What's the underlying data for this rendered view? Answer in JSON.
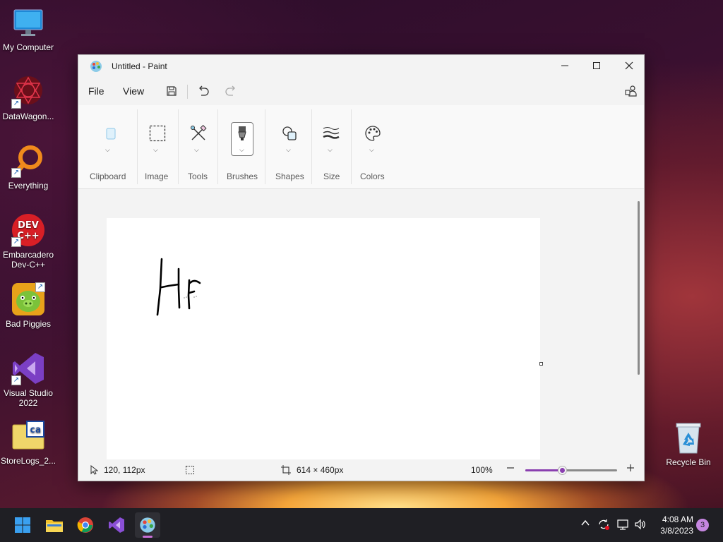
{
  "desktop": {
    "icons": [
      {
        "label": "My Computer"
      },
      {
        "label": "DataWagon..."
      },
      {
        "label": "Everything"
      },
      {
        "label": "Embarcadero Dev-C++"
      },
      {
        "label": "Bad Piggies"
      },
      {
        "label": "Visual Studio 2022"
      },
      {
        "label": "StoreLogs_2..."
      },
      {
        "label": "Recycle Bin"
      }
    ],
    "devcpp_badge": "DEV\nC++"
  },
  "window": {
    "title": "Untitled - Paint",
    "menu": {
      "file": "File",
      "view": "View"
    },
    "ribbon": {
      "groups": [
        {
          "label": "Clipboard"
        },
        {
          "label": "Image"
        },
        {
          "label": "Tools"
        },
        {
          "label": "Brushes"
        },
        {
          "label": "Shapes"
        },
        {
          "label": "Size"
        },
        {
          "label": "Colors"
        }
      ]
    },
    "status": {
      "cursor_pos": "120, 112px",
      "canvas_size": "614 × 460px",
      "zoom": "100%",
      "zoom_fraction": 0.4
    },
    "colors": {
      "accent": "#8a3fb0"
    }
  },
  "taskbar": {
    "time": "4:08 AM",
    "date": "3/8/2023",
    "notifications": "3"
  }
}
